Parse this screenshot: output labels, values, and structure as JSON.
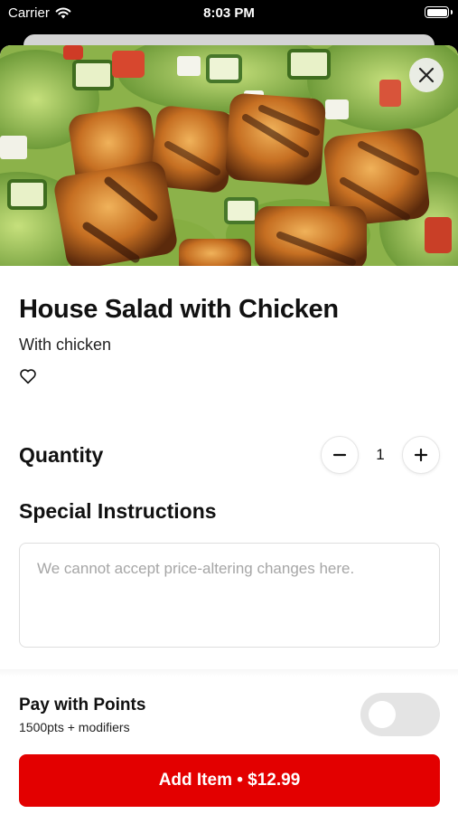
{
  "status_bar": {
    "carrier": "Carrier",
    "time": "8:03 PM",
    "icons": [
      "wifi-icon",
      "battery-icon"
    ]
  },
  "item": {
    "image_alt": "Grilled chicken salad",
    "title": "House Salad with Chicken",
    "subtitle": "With chicken",
    "favorite_icon": "heart-outline-icon",
    "close_icon": "close-icon"
  },
  "quantity": {
    "label": "Quantity",
    "value": "1",
    "decrement_icon": "minus-icon",
    "increment_icon": "plus-icon"
  },
  "special_instructions": {
    "label": "Special Instructions",
    "placeholder": "We cannot accept price-altering changes here."
  },
  "points": {
    "label": "Pay with Points",
    "sub": "1500pts + modifiers",
    "enabled": false
  },
  "add_button": {
    "label": "Add Item • $12.99",
    "color": "#e30000"
  }
}
